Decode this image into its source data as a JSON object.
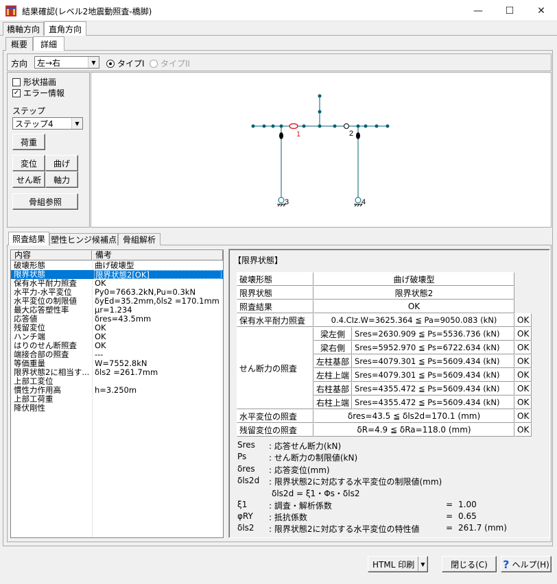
{
  "window": {
    "title": "結果確認(レベル2地震動照査-橋脚)",
    "minimize": "—",
    "maximize": "☐",
    "close": "✕"
  },
  "tabs_top": [
    "橋軸方向",
    "直角方向"
  ],
  "tabs_second": [
    "概要",
    "詳細"
  ],
  "direction": {
    "label": "方向",
    "value": "左→右",
    "type1": "タイプI",
    "type2": "タイプII"
  },
  "side": {
    "shape_draw": "形状描画",
    "error_info": "エラー情報",
    "step_label": "ステップ",
    "step_value": "ステップ4",
    "load_btn": "荷重",
    "disp_btn": "変位",
    "bend_btn": "曲げ",
    "shear_btn": "せん断",
    "axial_btn": "軸力",
    "frame_btn": "骨組参照"
  },
  "diagram": {
    "node_labels": [
      "1",
      "2",
      "3",
      "4"
    ],
    "hinge_color": "#e02020",
    "member_color": "#006070"
  },
  "tabs_bottom": [
    "照査結果",
    "塑性ヒンジ候補点",
    "骨組解析"
  ],
  "list": {
    "headers": [
      "内容",
      "備考"
    ],
    "rows": [
      [
        "破壊形態",
        "曲げ破壊型"
      ],
      [
        "限界状態",
        "限界状態2[OK]"
      ],
      [
        "保有水平耐力照査",
        "OK"
      ],
      [
        "水平力-水平変位",
        "Py0=7663.2kN,Pu=0.3kN"
      ],
      [
        "水平変位の制限値",
        "δyEd=35.2mm,δls2 =170.1mm"
      ],
      [
        "最大応答塑性率",
        "μr=1.234"
      ],
      [
        "応答値",
        "δres=43.5mm"
      ],
      [
        "残留変位",
        "OK"
      ],
      [
        "ハンチ端",
        "OK"
      ],
      [
        "はりのせん断照査",
        "OK"
      ],
      [
        "端接合部の照査",
        "---"
      ],
      [
        "等価重量",
        "W=7552.8kN"
      ],
      [
        "限界状態2に相当す...",
        "δls2 =261.7mm"
      ],
      [
        "上部工変位",
        ""
      ],
      [
        "慣性力作用高",
        "h=3.250m"
      ],
      [
        "上部工荷重",
        ""
      ],
      [
        "降伏剛性",
        ""
      ]
    ],
    "selected_index": 1
  },
  "detail": {
    "heading": "【限界状態】",
    "rows": {
      "fracture_label": "破壊形態",
      "fracture_value": "曲げ破壊型",
      "limit_label": "限界状態",
      "limit_value": "限界状態2",
      "result_label": "照査結果",
      "result_value": "OK",
      "hcap_label": "保有水平耐力照査",
      "hcap_value": "0.4.CIz.W=3625.364 ≦ Pa=9050.083 (kN)",
      "hcap_ok": "OK",
      "shear_label": "せん断力の照査",
      "shear_rows": [
        {
          "part": "梁左側",
          "value": "Sres=2630.909 ≦ Ps=5536.736 (kN)",
          "ok": "OK"
        },
        {
          "part": "梁右側",
          "value": "Sres=5952.970 ≦ Ps=6722.634 (kN)",
          "ok": "OK"
        },
        {
          "part": "左柱基部",
          "value": "Sres=4079.301 ≦ Ps=5609.434 (kN)",
          "ok": "OK"
        },
        {
          "part": "左柱上端",
          "value": "Sres=4079.301 ≦ Ps=5609.434 (kN)",
          "ok": "OK"
        },
        {
          "part": "右柱基部",
          "value": "Sres=4355.472 ≦ Ps=5609.434 (kN)",
          "ok": "OK"
        },
        {
          "part": "右柱上端",
          "value": "Sres=4355.472 ≦ Ps=5609.434 (kN)",
          "ok": "OK"
        }
      ],
      "hdisp_label": "水平変位の照査",
      "hdisp_value": "δres=43.5 ≦ δls2d=170.1 (mm)",
      "hdisp_ok": "OK",
      "rdisp_label": "残留変位の照査",
      "rdisp_value": "δR=4.9 ≦ δRa=118.0 (mm)",
      "rdisp_ok": "OK"
    },
    "notes": [
      {
        "sym": "Sres",
        "desc": ": 応答せん断力(kN)"
      },
      {
        "sym": "Ps",
        "desc": ": せん断力の制限値(kN)"
      },
      {
        "sym": "δres",
        "desc": ": 応答変位(mm)"
      },
      {
        "sym": "δls2d",
        "desc": ": 限界状態2に対応する水平変位の制限値(mm)"
      },
      {
        "sym": "",
        "desc": "δls2d = ξ1・Φs・δls2"
      },
      {
        "sym": "ξ1",
        "desc": ": 調査・解析係数",
        "eq": "=",
        "val": "1.00"
      },
      {
        "sym": "φRY",
        "desc": ": 抵抗係数",
        "eq": "=",
        "val": "0.65"
      },
      {
        "sym": "δls2",
        "desc": ": 限界状態2に対応する水平変位の特性値",
        "eq": "=",
        "val": "261.7 (mm)"
      }
    ]
  },
  "footer": {
    "html_print": "HTML 印刷",
    "close": "閉じる(C)",
    "help": "ヘルプ(H)"
  }
}
